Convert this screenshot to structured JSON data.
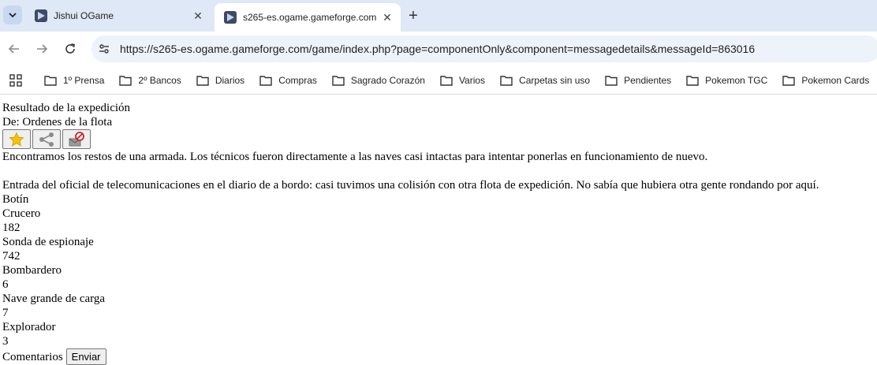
{
  "browser": {
    "tabs": [
      {
        "title": "Jishui OGame",
        "active": false
      },
      {
        "title": "s265-es.ogame.gameforge.com",
        "active": true
      }
    ],
    "new_tab": "+",
    "close_glyph": "✕",
    "url": "https://s265-es.ogame.gameforge.com/game/index.php?page=componentOnly&component=messagedetails&messageId=863016",
    "bookmarks": [
      "1º Prensa",
      "2º Bancos",
      "Diarios",
      "Compras",
      "Sagrado Corazón",
      "Varios",
      "Carpetas sin uso",
      "Pendientes",
      "Pokemon TGC",
      "Pokemon Cards"
    ]
  },
  "message": {
    "title": "Resultado de la expedición",
    "from": "De: Ordenes de la flota",
    "body_1": "Encontramos los restos de una armada. Los técnicos fueron directamente a las naves casi intactas para intentar ponerlas en funcionamiento de nuevo.",
    "body_2": "Entrada del oficial de telecomunicaciones en el diario de a bordo: casi tuvimos una colisión con otra flota de expedición. No sabía que hubiera otra gente rondando por aquí.",
    "loot_label": "Botín",
    "loot": [
      {
        "name": "Crucero",
        "count": "182"
      },
      {
        "name": "Sonda de espionaje",
        "count": "742"
      },
      {
        "name": "Bombardero",
        "count": "6"
      },
      {
        "name": "Nave grande de carga",
        "count": "7"
      },
      {
        "name": "Explorador",
        "count": "3"
      }
    ],
    "comments_label": "Comentarios",
    "send_label": "Enviar"
  },
  "icons": {
    "favorite": "star-icon",
    "share": "share-icon",
    "report": "report-icon"
  },
  "colors": {
    "tabstrip": "#dfe8f6",
    "omnibox": "#eef2fa",
    "star": "#f5c400"
  }
}
